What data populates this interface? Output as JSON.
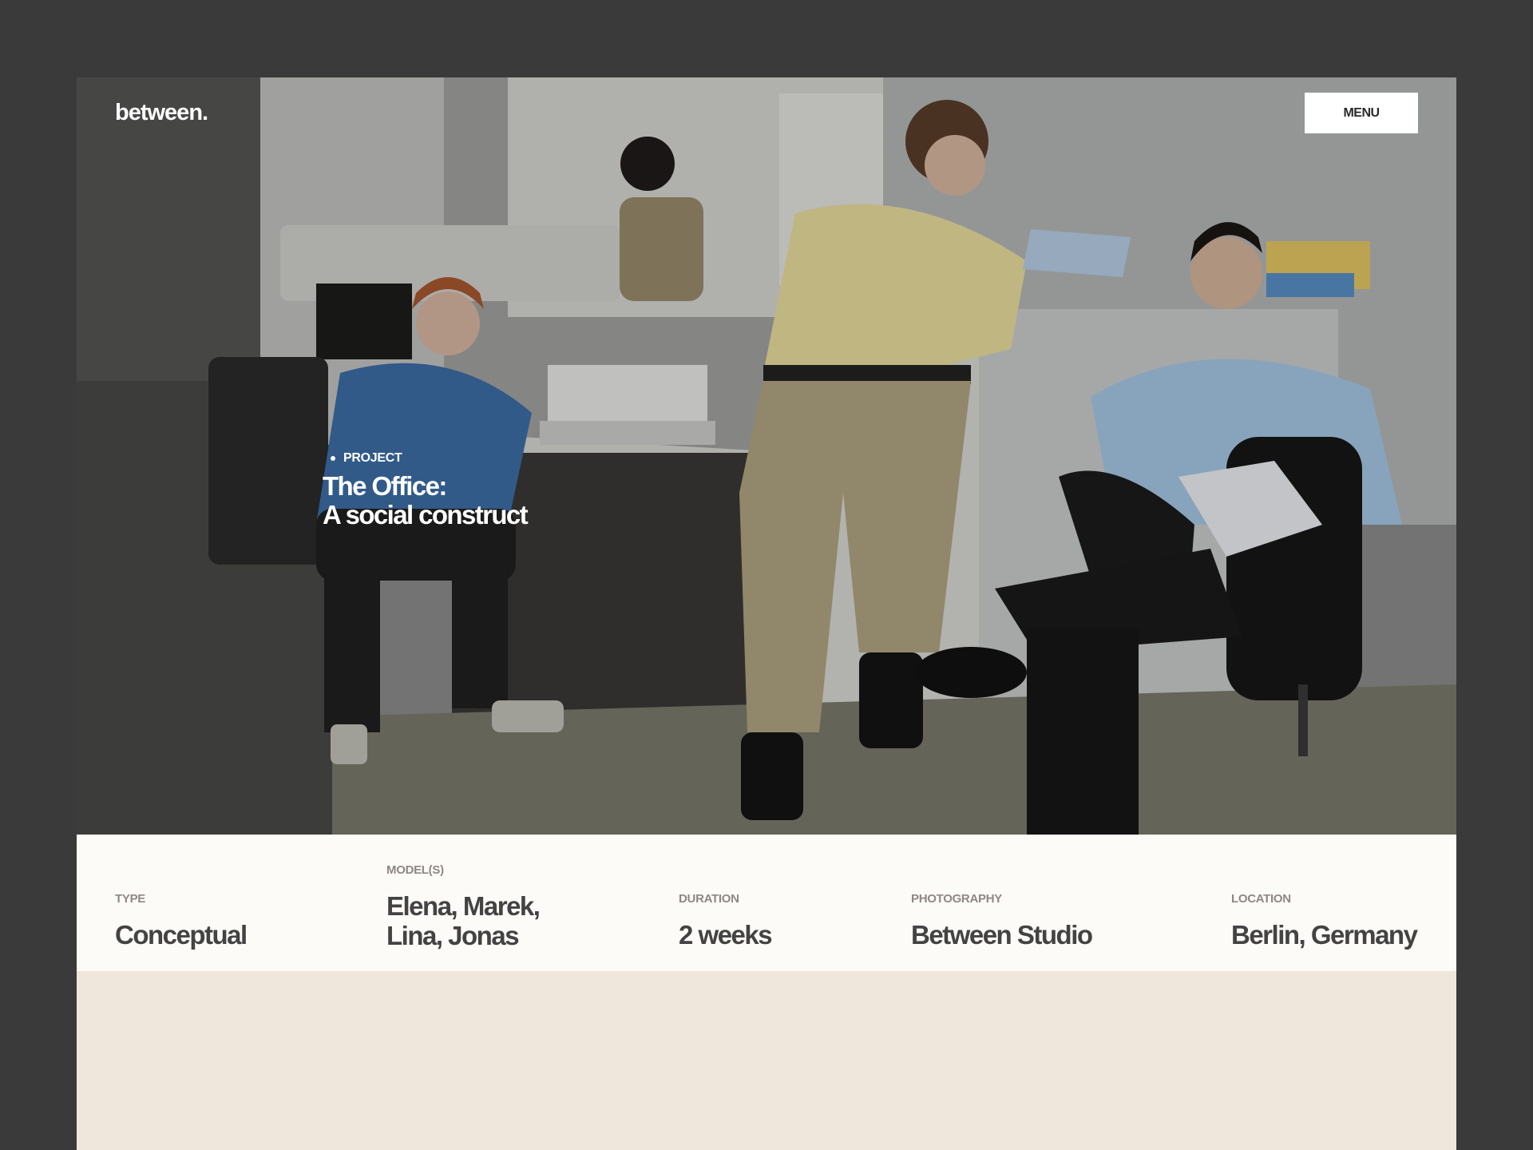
{
  "header": {
    "logo": "between.",
    "menu_label": "MENU"
  },
  "hero": {
    "tag": "PROJECT",
    "title_line1": "The Office:",
    "title_line2": "A social construct"
  },
  "details": [
    {
      "label": "TYPE",
      "value": "Conceptual"
    },
    {
      "label": "MODEL(S)",
      "value_line1": "Elena, Marek,",
      "value_line2": "Lina, Jonas"
    },
    {
      "label": "DURATION",
      "value": "2 weeks"
    },
    {
      "label": "PHOTOGRAPHY",
      "value": "Between Studio"
    },
    {
      "label": "LOCATION",
      "value": "Berlin, Germany"
    }
  ],
  "colors": {
    "outer_bg": "#3a3a3a",
    "info_bg": "#fdfbf8",
    "lower_bg": "#efe6dc",
    "label": "#8f8784",
    "value": "#434343"
  }
}
